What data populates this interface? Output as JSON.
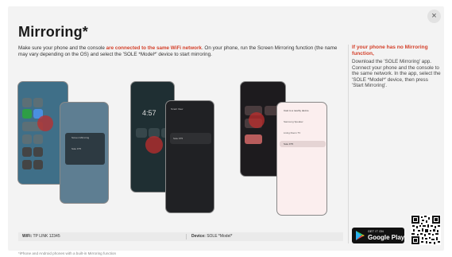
{
  "modal": {
    "title": "Mirroring*",
    "close_glyph": "×",
    "intro_before": "Make sure your phone and the console ",
    "intro_highlight": "are connected to the same WiFi network",
    "intro_after": ". On your phone, run the Screen Mirroring function (the name may vary depending on the OS) and select the 'SOLE *Model*' device to start mirroring."
  },
  "side": {
    "title": "If your phone has no Mirroring function,",
    "body": "Download the 'SOLE Mirroring' app. Connect your phone and the console to the same network. In the app, select the 'SOLE *Model*' device, then press 'Start Mirroring'."
  },
  "store": {
    "get_it_on": "GET IT ON",
    "name": "Google Play"
  },
  "info": {
    "wifi_label": "WiFi:",
    "wifi_value": "TP LINK 12345",
    "device_label": "Device:",
    "device_value": "SOLE *Model*"
  },
  "footnote": "*iPhone and Android phones with a built-in Mirroring function",
  "illustrations": {
    "iphone_popup_title": "Screen Mirroring",
    "iphone_popup_device": "Sole FT5",
    "samsung_time": "4:57",
    "samsung_panel_title": "Smart View",
    "samsung_device": "Sole FT5",
    "pixel_panel_title": "Cast to a nearby device",
    "pixel_device_1": "Samsung Speaker",
    "pixel_device_2": "Living Room TV",
    "pixel_device_3": "Sole FT5"
  },
  "colors": {
    "accent_red": "#d4412b",
    "modal_bg": "#f3f3f3",
    "play_store_bg": "#111111"
  },
  "icons": [
    "close-icon",
    "google-play-icon",
    "qr-code"
  ]
}
